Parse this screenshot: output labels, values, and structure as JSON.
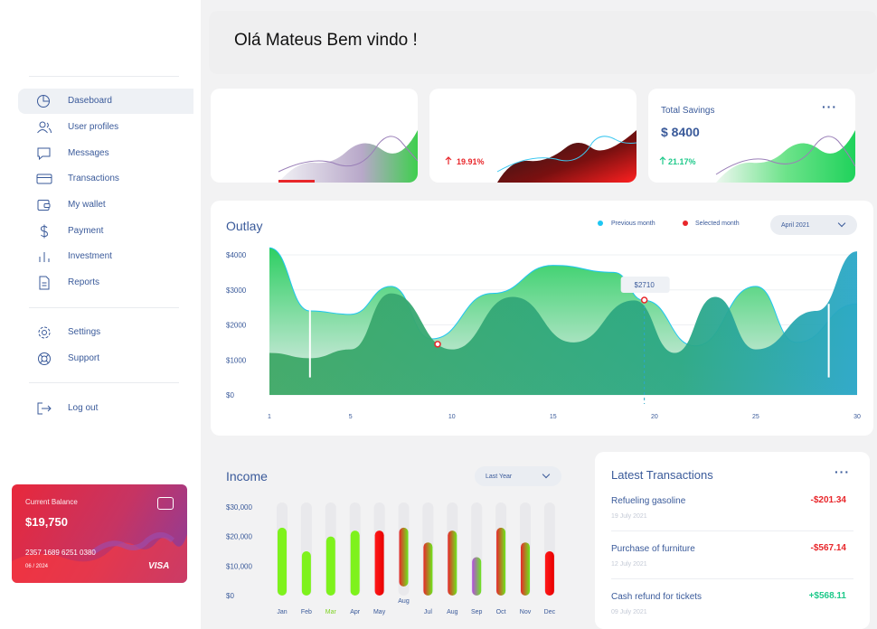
{
  "header": {
    "greeting": "Olá Mateus Bem vindo !"
  },
  "sidebar": {
    "items": [
      {
        "label": "Daseboard",
        "icon": "pie-chart-icon",
        "active": true
      },
      {
        "label": "User profiles",
        "icon": "users-icon"
      },
      {
        "label": "Messages",
        "icon": "message-icon"
      },
      {
        "label": "Transactions",
        "icon": "credit-card-icon"
      },
      {
        "label": "My wallet",
        "icon": "wallet-icon"
      },
      {
        "label": "Payment",
        "icon": "dollar-icon"
      },
      {
        "label": "Investment",
        "icon": "bar-chart-icon"
      },
      {
        "label": "Reports",
        "icon": "document-icon"
      }
    ],
    "secondary": [
      {
        "label": "Settings",
        "icon": "gear-icon"
      },
      {
        "label": "Support",
        "icon": "lifebuoy-icon"
      }
    ],
    "logout": {
      "label": "Log out",
      "icon": "logout-icon"
    }
  },
  "card": {
    "label": "Current Balance",
    "amount": "$19,750",
    "number": "2357 1689 6251 0380",
    "expiry": "06 / 2024",
    "brand": "VISA"
  },
  "kpis": {
    "middle": {
      "change": "19.91%",
      "change_color": "#e8262a"
    },
    "savings": {
      "title": "Total Savings",
      "amount": "$ 8400",
      "change": "21.17%",
      "change_color": "#1ec98a"
    }
  },
  "outlay": {
    "title": "Outlay",
    "legend": [
      {
        "label": "Previous month",
        "color": "#1ec6f2"
      },
      {
        "label": "Selected month",
        "color": "#e8262a"
      }
    ],
    "period": "April 2021",
    "tooltip": "$2710"
  },
  "income": {
    "title": "Income",
    "period": "Last Year"
  },
  "transactions": {
    "title": "Latest Transactions",
    "items": [
      {
        "name": "Refueling gasoline",
        "date": "19 July 2021",
        "amount": "-$201.34",
        "color": "#e8262a"
      },
      {
        "name": "Purchase of furniture",
        "date": "12 July 2021",
        "amount": "-$567.14",
        "color": "#e8262a"
      },
      {
        "name": "Cash refund for tickets",
        "date": "09 July 2021",
        "amount": "+$568.11",
        "color": "#1ec98a"
      }
    ]
  },
  "chart_data": [
    {
      "type": "area",
      "title": "Outlay",
      "x_ticks": [
        1,
        5,
        10,
        15,
        20,
        25,
        30
      ],
      "y_ticks": [
        "$4000",
        "$3000",
        "$2000",
        "$1000",
        "$0"
      ],
      "ylim": [
        0,
        4000
      ],
      "xlim": [
        1,
        30
      ],
      "series": [
        {
          "name": "Previous month",
          "x": [
            1,
            3,
            5,
            7,
            10,
            13,
            16,
            19,
            21,
            23,
            25,
            28,
            30
          ],
          "values": [
            1200,
            1050,
            1300,
            2900,
            1300,
            2800,
            1500,
            2700,
            1200,
            2800,
            1300,
            2400,
            4100
          ]
        },
        {
          "name": "Selected month",
          "x": [
            1,
            3,
            5,
            7,
            9,
            12,
            15,
            18,
            19.5,
            22,
            25,
            27,
            30
          ],
          "values": [
            4200,
            2400,
            2300,
            3100,
            1600,
            2900,
            3700,
            3500,
            2700,
            1400,
            3100,
            1500,
            2600
          ]
        }
      ],
      "annotations": [
        {
          "x": 19.5,
          "y": 2710,
          "text": "$2710"
        }
      ]
    },
    {
      "type": "bar",
      "title": "Income",
      "categories": [
        "Jan",
        "Feb",
        "Mar",
        "Apr",
        "May",
        "Aug",
        "Jul",
        "Aug",
        "Sep",
        "Oct",
        "Nov",
        "Dec"
      ],
      "values": [
        23000,
        15000,
        20000,
        22000,
        22000,
        23000,
        18000,
        22000,
        13000,
        23000,
        18000,
        15000
      ],
      "ylim": [
        0,
        30000
      ],
      "y_ticks": [
        "$30,000",
        "$20,000",
        "$10,000",
        "$0"
      ]
    }
  ]
}
